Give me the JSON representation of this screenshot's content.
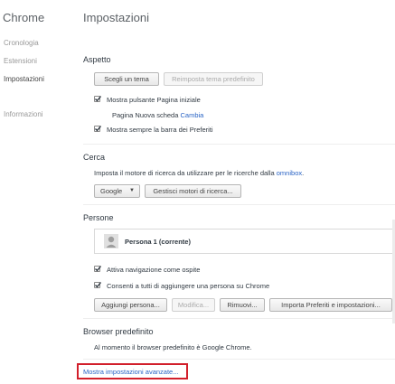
{
  "sidebar": {
    "brand": "Chrome",
    "items": [
      {
        "label": "Cronologia"
      },
      {
        "label": "Estensioni"
      },
      {
        "label": "Impostazioni"
      },
      {
        "label": "Informazioni"
      }
    ],
    "selected": "Impostazioni"
  },
  "main": {
    "title": "Impostazioni",
    "aspetto": {
      "title": "Aspetto",
      "choose_theme": "Scegli un tema",
      "reset_theme": "Reimposta tema predefinito",
      "show_home": "Mostra pulsante Pagina iniziale",
      "show_home_checked": true,
      "homepage_text": "Pagina Nuova scheda",
      "change_link": "Cambia",
      "show_bookmarks": "Mostra sempre la barra dei Preferiti",
      "show_bookmarks_checked": true
    },
    "cerca": {
      "title": "Cerca",
      "description": "Imposta il motore di ricerca da utilizzare per le ricerche dalla",
      "omnibox_link": "omnibox",
      "description_end": ".",
      "engine": "Google",
      "manage": "Gestisci motori di ricerca..."
    },
    "persone": {
      "title": "Persone",
      "profile_name": "Persona 1 (corrente)",
      "guest": "Attiva navigazione come ospite",
      "guest_checked": true,
      "add_anyone": "Consenti a tutti di aggiungere una persona su Chrome",
      "add_anyone_checked": true,
      "add_person": "Aggiungi persona...",
      "edit": "Modifica...",
      "remove": "Rimuovi...",
      "import": "Importa Preferiti e impostazioni..."
    },
    "browser": {
      "title": "Browser predefinito",
      "text": "Al momento il browser predefinito è Google Chrome."
    },
    "advanced_link": "Mostra impostazioni avanzate..."
  },
  "colors": {
    "link": "#2a64c5",
    "highlight_box": "#d21f2b"
  }
}
